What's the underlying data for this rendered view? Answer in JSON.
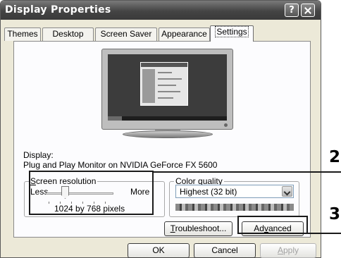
{
  "window": {
    "title": "Display Properties",
    "help_button": "?"
  },
  "tabs": [
    {
      "label": "Themes"
    },
    {
      "label": "Desktop"
    },
    {
      "label": "Screen Saver"
    },
    {
      "label": "Appearance"
    },
    {
      "label": "Settings",
      "active": true
    }
  ],
  "display": {
    "label": "Display:",
    "device": "Plug and Play Monitor on NVIDIA GeForce FX 5600"
  },
  "screen_resolution": {
    "title": "Screen resolution",
    "title_accel": "S",
    "title_rest": "creen resolution",
    "less_label": "Less",
    "more_label": "More",
    "value": "1024 by 768 pixels"
  },
  "color_quality": {
    "title": "Color quality",
    "title_accel": "C",
    "title_rest": "olor quality",
    "selected": "Highest (32 bit)"
  },
  "buttons": {
    "troubleshoot": {
      "accel": "T",
      "rest": "roubleshoot..."
    },
    "advanced": {
      "pre": "Ad",
      "accel": "v",
      "post": "anced"
    },
    "ok": "OK",
    "cancel": "Cancel",
    "apply": {
      "accel": "A",
      "rest": "pply"
    }
  },
  "callouts": {
    "two": "2",
    "three": "3"
  },
  "colors": {
    "titlebar": "#444444",
    "dialog_bg": "#ece9d8",
    "panel_bg": "#fcfcfe",
    "callout": "#1a1a1a"
  }
}
